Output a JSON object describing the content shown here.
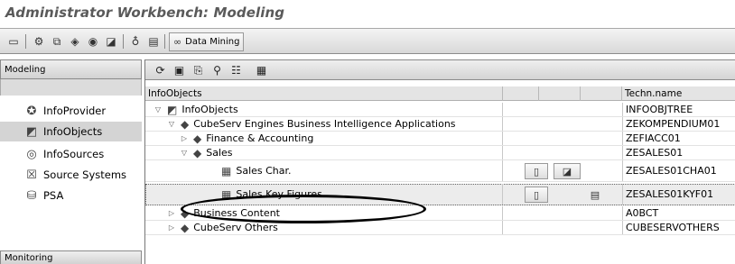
{
  "title": "Administrator Workbench: Modeling",
  "toolbar": {
    "data_mining_label": "Data Mining",
    "icons": [
      "screen-icon",
      "transport-icon",
      "infoset-icon",
      "cube-icon",
      "source-icon",
      "infoobject-icon",
      "hierarchy-icon",
      "document-icon",
      "data-mining-icon"
    ]
  },
  "left_panel": {
    "header": "Modeling",
    "footer": "Monitoring",
    "items": [
      {
        "label": "InfoProvider",
        "icon": "infoprovider-icon",
        "selected": false
      },
      {
        "label": "InfoObjects",
        "icon": "infoobjects-icon",
        "selected": true
      },
      {
        "label": "InfoSources",
        "icon": "infosources-icon",
        "selected": false
      },
      {
        "label": "Source Systems",
        "icon": "source-systems-icon",
        "selected": false
      },
      {
        "label": "PSA",
        "icon": "psa-icon",
        "selected": false
      }
    ]
  },
  "grid": {
    "columns": [
      "InfoObjects",
      "Techn.name"
    ],
    "rows": [
      {
        "label": "InfoObjects",
        "tech": "INFOOBJTREE",
        "expanded": true
      },
      {
        "label": "CubeServ Engines Business Intelligence Applications",
        "tech": "ZEKOMPENDIUM01",
        "expanded": true
      },
      {
        "label": "Finance & Accounting",
        "tech": "ZEFIACC01",
        "expanded": false
      },
      {
        "label": "Sales",
        "tech": "ZESALES01",
        "expanded": true
      },
      {
        "label": "Sales Char.",
        "tech": "ZESALES01CHA01"
      },
      {
        "label": "Sales Key Figures",
        "tech": "ZESALES01KYF01",
        "selected": true
      },
      {
        "label": "Business Content",
        "tech": "A0BCT",
        "expanded": false
      },
      {
        "label": "CubeServ Others",
        "tech": "CUBESERVOTHERS",
        "expanded": false
      }
    ]
  }
}
